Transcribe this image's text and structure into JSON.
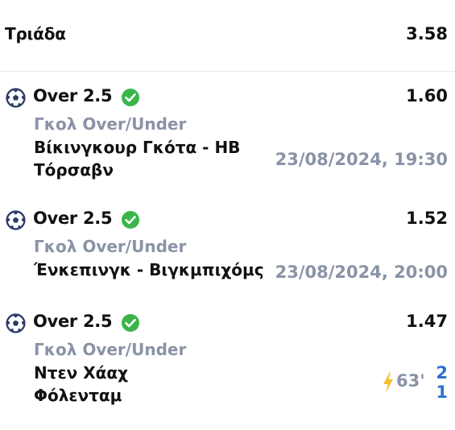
{
  "header": {
    "title": "Τριάδα",
    "total_odds": "3.58"
  },
  "selections": [
    {
      "pick": "Over 2.5",
      "odds": "1.60",
      "market": "Γκολ Over/Under",
      "team_line1": "Βίκινγκουρ Γκότα - ΗΒ",
      "team_line2": "Τόρσαβν",
      "datetime": "23/08/2024, 19:30"
    },
    {
      "pick": "Over 2.5",
      "odds": "1.52",
      "market": "Γκολ Over/Under",
      "team_line1": "Ένκεπινγκ - Βιγκμπιχόμς",
      "datetime": "23/08/2024, 20:00"
    },
    {
      "pick": "Over 2.5",
      "odds": "1.47",
      "market": "Γκολ Over/Under",
      "team_line1": "Ντεν Χάαχ",
      "team_line2": "Φόλενταμ",
      "live_minute": "63'",
      "score_home": "2",
      "score_away": "1"
    }
  ],
  "icons": {
    "sport": "soccer-ball-icon",
    "status": "check-circle-icon",
    "live": "lightning-icon"
  },
  "colors": {
    "check": "#3bb54a",
    "market_text": "#8a93a6",
    "score": "#2f6fd0",
    "bolt": "#f2c02e",
    "ball": "#2b3a66"
  }
}
